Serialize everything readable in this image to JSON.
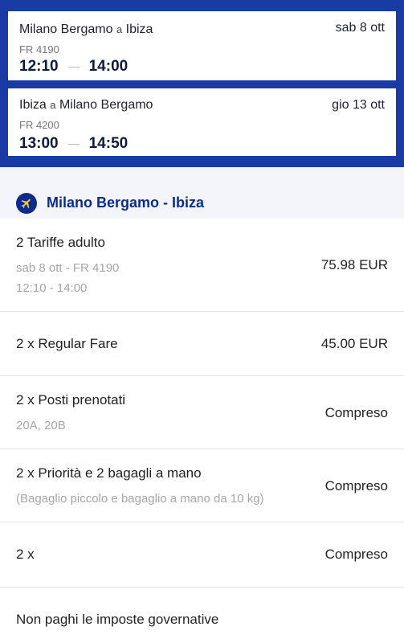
{
  "flights": [
    {
      "origin": "Milano Bergamo",
      "connector": "a",
      "destination": "Ibiza",
      "date": "sab 8 ott",
      "flight_no": "FR 4190",
      "depart": "12:10",
      "arrive": "14:00"
    },
    {
      "origin": "Ibiza",
      "connector": "a",
      "destination": "Milano Bergamo",
      "date": "gio 13 ott",
      "flight_no": "FR 4200",
      "depart": "13:00",
      "arrive": "14:50"
    }
  ],
  "section": {
    "icon": "plane-icon",
    "title": "Milano Bergamo - Ibiza"
  },
  "rows": [
    {
      "title": "2 Tariffe adulto",
      "sub1": "sab 8 ott - FR 4190",
      "sub2": "12:10 - 14:00",
      "value": "75.98 EUR"
    },
    {
      "title": "2 x Regular Fare",
      "value": "45.00 EUR"
    },
    {
      "title": "2 x Posti prenotati",
      "sub1": "20A, 20B",
      "value": "Compreso"
    },
    {
      "title": "2 x Priorità e 2 bagagli a mano",
      "sub1": "(Bagaglio piccolo e bagaglio a mano da 10 kg)",
      "value": "Compreso"
    },
    {
      "title": "2 x",
      "value": "Compreso"
    },
    {
      "title": "Non paghi le imposte governative"
    }
  ],
  "colors": {
    "brand_blue": "#1a3aa6",
    "dark_blue": "#0c2c8c",
    "accent_yellow": "#f1c933"
  }
}
